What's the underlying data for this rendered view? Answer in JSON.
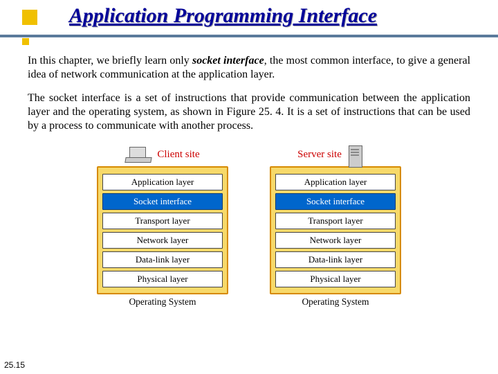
{
  "title": "Application Programming Interface",
  "para1_a": "In this chapter, we briefly learn only ",
  "para1_b": "socket interface",
  "para1_c": ", the most common interface, to give a general idea of network communication at the application layer.",
  "para2": "The socket interface is a set of instructions that provide communication between the application layer and the operating system, as shown in Figure 25. 4. It is a set of instructions that can be used by a process to communicate with another process.",
  "client_label": "Client site",
  "server_label": "Server site",
  "layers": {
    "app": "Application layer",
    "socket": "Socket interface",
    "transport": "Transport layer",
    "network": "Network layer",
    "datalink": "Data-link layer",
    "physical": "Physical layer"
  },
  "os_label": "Operating System",
  "page_num": "25.15"
}
